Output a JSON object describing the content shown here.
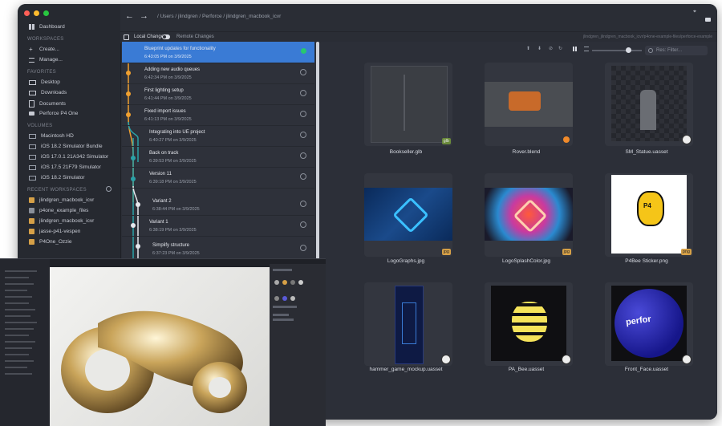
{
  "sidebar": {
    "items_top": [
      {
        "label": "Dashboard",
        "icon": "grid-icon"
      }
    ],
    "workspaces_header": "WORKSPACES",
    "workspace_actions": [
      {
        "label": "Create...",
        "icon": "plus-icon"
      },
      {
        "label": "Manage...",
        "icon": "list-icon"
      }
    ],
    "favorites_header": "FAVORITES",
    "favorites": [
      {
        "label": "Desktop",
        "icon": "monitor-icon"
      },
      {
        "label": "Downloads",
        "icon": "download-icon"
      },
      {
        "label": "Documents",
        "icon": "document-icon"
      },
      {
        "label": "Perforce P4 One",
        "icon": "folder-icon"
      }
    ],
    "volumes_header": "VOLUMES",
    "volumes": [
      {
        "label": "Macintosh HD"
      },
      {
        "label": "iOS 18.2 Simulator Bundle"
      },
      {
        "label": "iOS 17.0.1 21A342 Simulator"
      },
      {
        "label": "iOS 17.5 21F79 Simulator"
      },
      {
        "label": "iOS 18.2 Simulator"
      }
    ],
    "recent_header": "RECENT WORKSPACES",
    "recent": [
      {
        "label": "jlindgren_macbook_icvr"
      },
      {
        "label": "p4one_example_files"
      },
      {
        "label": "jlindgren_macbook_icvr"
      },
      {
        "label": "jasse-p41-vespen"
      },
      {
        "label": "P4One_Ozzie"
      }
    ]
  },
  "toolbar": {
    "breadcrumb": "/ Users / jlindgren / Perforce / jlindgren_macbook_icvr",
    "back": "←",
    "forward": "→"
  },
  "subbar": {
    "local_changes": "Local Changes",
    "remote_changes": "Remote Changes",
    "path": "jlindgren_jlindgren_macbook_icvr/p4one-example-files/perforce-example"
  },
  "history": [
    {
      "title": "Blueprint updates for functionality",
      "date": "6:43:05 PM on 3/9/2025",
      "selected": true
    },
    {
      "title": "Adding new audio queues",
      "date": "6:42:34 PM on 3/9/2025"
    },
    {
      "title": "First lighting setup",
      "date": "6:41:44 PM on 3/9/2025"
    },
    {
      "title": "Fixed import issues",
      "date": "6:41:13 PM on 3/9/2025"
    },
    {
      "title": "Integrating into UE project",
      "date": "6:40:27 PM on 3/9/2025"
    },
    {
      "title": "Back on track",
      "date": "6:39:53 PM on 3/9/2025"
    },
    {
      "title": "Version 11",
      "date": "6:39:18 PM on 3/9/2025"
    },
    {
      "title": "Variant 2",
      "date": "6:38:44 PM on 3/9/2025"
    },
    {
      "title": "Variant 1",
      "date": "6:38:19 PM on 3/9/2025"
    },
    {
      "title": "Simplify structure",
      "date": "6:37:23 PM on 3/9/2025"
    }
  ],
  "grid": {
    "filter_placeholder": "Res: Filter...",
    "files": [
      {
        "name": "Bookseller.glb",
        "badge": "glb"
      },
      {
        "name": "Rover.blend",
        "badge": ""
      },
      {
        "name": "SM_Statue.uasset",
        "badge": ""
      },
      {
        "name": "LogoGraphs.jpg",
        "badge": "jpg"
      },
      {
        "name": "LogoSplashColor.jpg",
        "badge": "jpg"
      },
      {
        "name": "P4Bee Sticker.png",
        "badge": "png"
      },
      {
        "name": "hammer_game_mockup.uasset",
        "badge": ""
      },
      {
        "name": "PA_Bee.uasset",
        "badge": ""
      },
      {
        "name": "Front_Face.uasset",
        "badge": ""
      }
    ],
    "sticker_text": "P4",
    "ball_text": "perfor"
  },
  "colors": {
    "accent": "#3a7bd5",
    "branch_orange": "#f0a030",
    "branch_teal": "#2aa2a8",
    "branch_white": "#e6e8ee"
  }
}
